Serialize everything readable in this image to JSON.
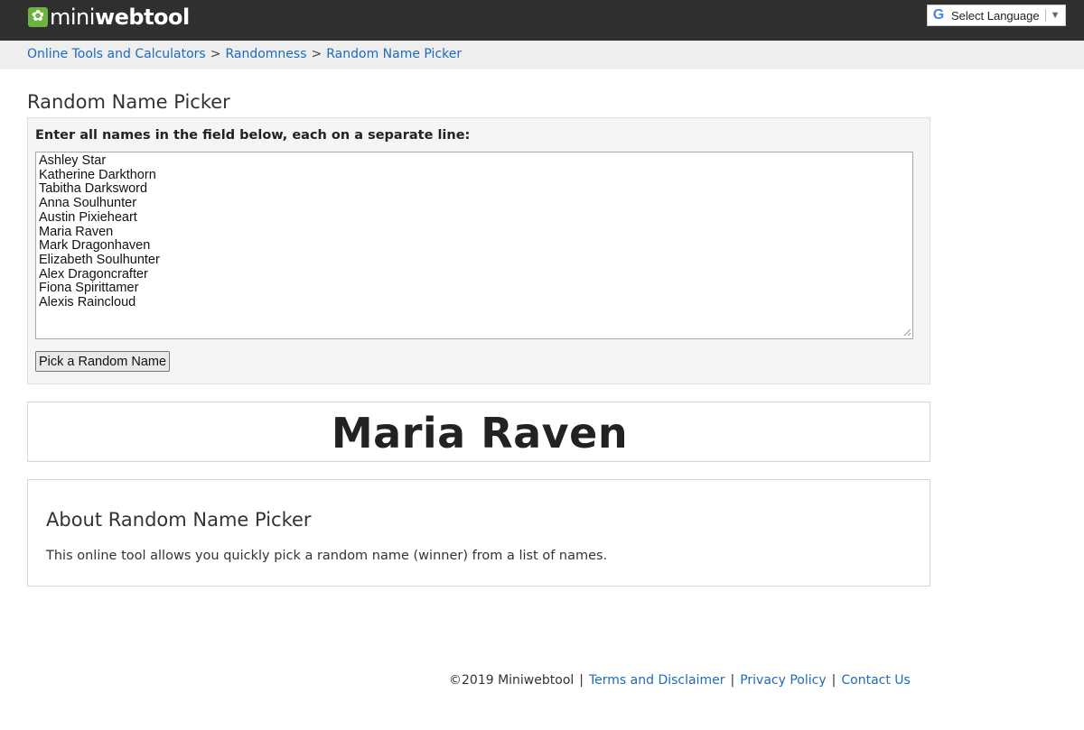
{
  "header": {
    "logo_mini": "mini",
    "logo_web": "webtool",
    "logo_icon": "gear-icon",
    "language_label": "Select Language",
    "language_arrow": "▼",
    "brand_color": "#6db33f",
    "bar_color": "#2f2f2f"
  },
  "breadcrumb": {
    "items": [
      "Online Tools and Calculators",
      "Randomness",
      "Random Name Picker"
    ],
    "separator": ">",
    "link_color": "#1e6bb8"
  },
  "page_title": "Random Name Picker",
  "form": {
    "label": "Enter all names in the field below, each on a separate line:",
    "names": [
      "Ashley Star",
      "Katherine Darkthorn",
      "Tabitha Darksword",
      "Anna Soulhunter",
      "Austin Pixieheart",
      "Maria Raven",
      "Mark Dragonhaven",
      "Elizabeth Soulhunter",
      "Alex Dragoncrafter",
      "Fiona Spirittamer",
      "Alexis Raincloud"
    ],
    "button_label": "Pick a Random Name"
  },
  "result": {
    "winner": "Maria Raven"
  },
  "about": {
    "title": "About Random Name Picker",
    "text": "This online tool allows you quickly pick a random name (winner) from a list of names."
  },
  "footer": {
    "copyright": "©2019 Miniwebtool",
    "links": [
      "Terms and Disclaimer",
      "Privacy Policy",
      "Contact Us"
    ],
    "separator": "|"
  }
}
